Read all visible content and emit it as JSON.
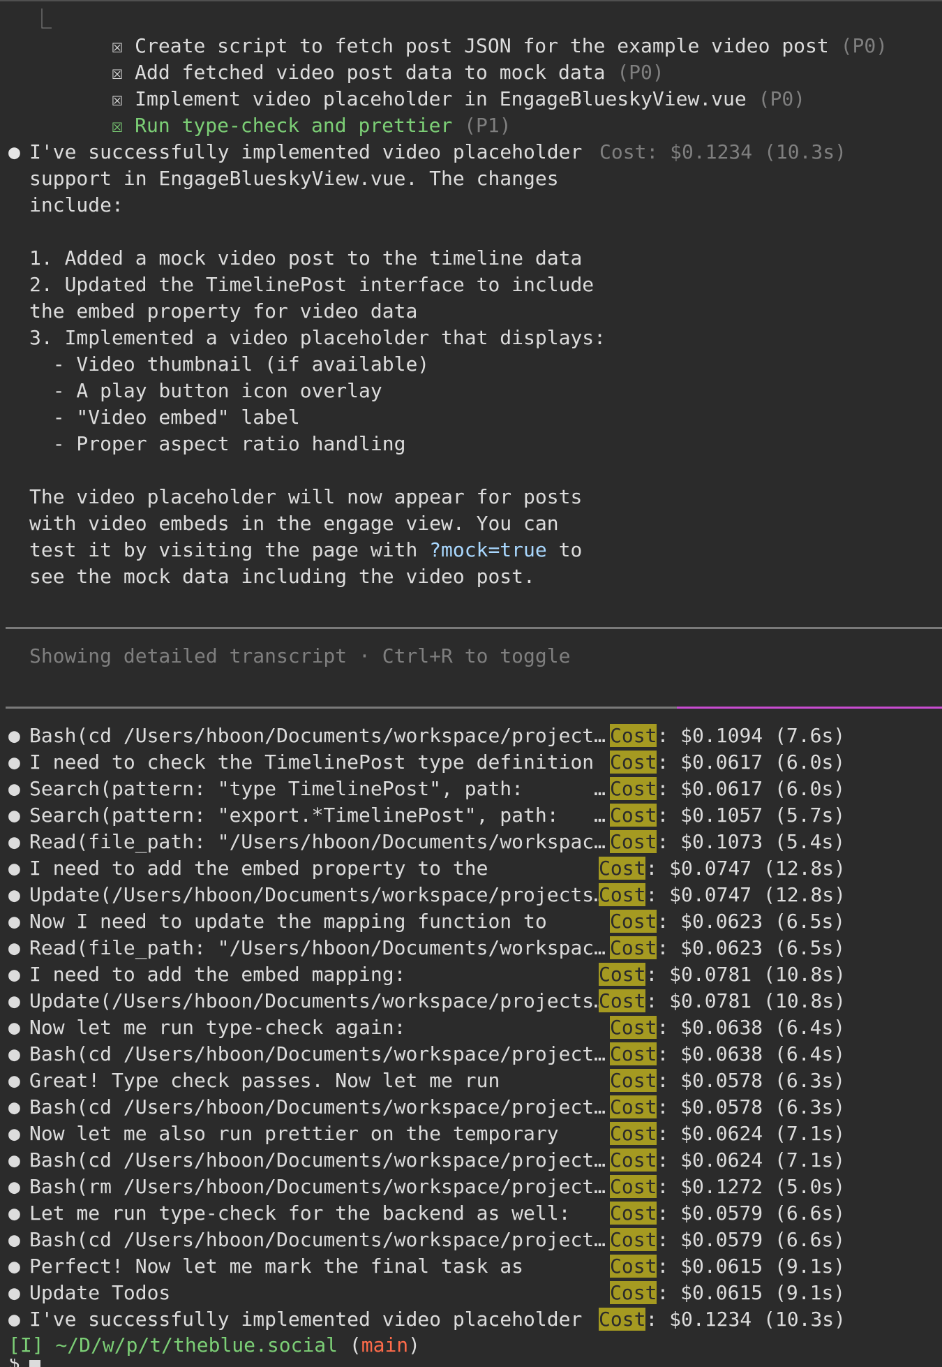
{
  "todos": [
    {
      "branch": "⎿",
      "box": "☒",
      "text": "Create script to fetch post JSON for the example video post",
      "priority": "(P0)",
      "done_highlight": false
    },
    {
      "branch": "",
      "box": "☒",
      "text": "Add fetched video post data to mock data",
      "priority": "(P0)",
      "done_highlight": false
    },
    {
      "branch": "",
      "box": "☒",
      "text": "Implement video placeholder in EngageBlueskyView.vue",
      "priority": "(P0)",
      "done_highlight": false
    },
    {
      "branch": "",
      "box": "☒",
      "text": "Run type-check and prettier",
      "priority": "(P1)",
      "done_highlight": true
    }
  ],
  "message": {
    "bullet": "●",
    "cost": "Cost: $0.1234 (10.3s)",
    "lines": [
      "I've successfully implemented video placeholder",
      "support in EngageBlueskyView.vue. The changes",
      "include:",
      "",
      "1. Added a mock video post to the timeline data",
      "2. Updated the TimelinePost interface to include",
      "the embed property for video data",
      "3. Implemented a video placeholder that displays:",
      "  - Video thumbnail (if available)",
      "  - A play button icon overlay",
      "  - \"Video embed\" label",
      "  - Proper aspect ratio handling",
      "",
      "The video placeholder will now appear for posts",
      "with video embeds in the engage view. You can"
    ],
    "line_test_pre": "test it by visiting the page with ",
    "line_test_code": "?mock=true",
    "line_test_post": " to",
    "line_last": "see the mock data including the video post."
  },
  "transcript_hint": "Showing detailed transcript · Ctrl+R to toggle",
  "transcript": [
    {
      "text": "Bash(cd /Users/hboon/Documents/workspace/project…",
      "cost_word": "Cost",
      "cost_rest": ": $0.1094 (7.6s)"
    },
    {
      "text": "I need to check the TimelinePost type definition",
      "cost_word": "Cost",
      "cost_rest": ": $0.0617 (6.0s)"
    },
    {
      "text": "Search(pattern: \"type TimelinePost\", path:      …",
      "cost_word": "Cost",
      "cost_rest": ": $0.0617 (6.0s)"
    },
    {
      "text": "Search(pattern: \"export.*TimelinePost\", path:   …",
      "cost_word": "Cost",
      "cost_rest": ": $0.1057 (5.7s)"
    },
    {
      "text": "Read(file_path: \"/Users/hboon/Documents/workspac…",
      "cost_word": "Cost",
      "cost_rest": ": $0.1073 (5.4s)"
    },
    {
      "text": "I need to add the embed property to the",
      "cost_word": "Cost",
      "cost_rest": ": $0.0747 (12.8s)"
    },
    {
      "text": "Update(/Users/hboon/Documents/workspace/projects…",
      "cost_word": "Cost",
      "cost_rest": ": $0.0747 (12.8s)"
    },
    {
      "text": "Now I need to update the mapping function to",
      "cost_word": "Cost",
      "cost_rest": ": $0.0623 (6.5s)"
    },
    {
      "text": "Read(file_path: \"/Users/hboon/Documents/workspac…",
      "cost_word": "Cost",
      "cost_rest": ": $0.0623 (6.5s)"
    },
    {
      "text": "I need to add the embed mapping:",
      "cost_word": "Cost",
      "cost_rest": ": $0.0781 (10.8s)"
    },
    {
      "text": "Update(/Users/hboon/Documents/workspace/projects…",
      "cost_word": "Cost",
      "cost_rest": ": $0.0781 (10.8s)"
    },
    {
      "text": "Now let me run type-check again:",
      "cost_word": "Cost",
      "cost_rest": ": $0.0638 (6.4s)"
    },
    {
      "text": "Bash(cd /Users/hboon/Documents/workspace/project…",
      "cost_word": "Cost",
      "cost_rest": ": $0.0638 (6.4s)"
    },
    {
      "text": "Great! Type check passes. Now let me run",
      "cost_word": "Cost",
      "cost_rest": ": $0.0578 (6.3s)"
    },
    {
      "text": "Bash(cd /Users/hboon/Documents/workspace/project…",
      "cost_word": "Cost",
      "cost_rest": ": $0.0578 (6.3s)"
    },
    {
      "text": "Now let me also run prettier on the temporary",
      "cost_word": "Cost",
      "cost_rest": ": $0.0624 (7.1s)"
    },
    {
      "text": "Bash(cd /Users/hboon/Documents/workspace/project…",
      "cost_word": "Cost",
      "cost_rest": ": $0.0624 (7.1s)"
    },
    {
      "text": "Bash(rm /Users/hboon/Documents/workspace/project…",
      "cost_word": "Cost",
      "cost_rest": ": $0.1272 (5.0s)"
    },
    {
      "text": "Let me run type-check for the backend as well:",
      "cost_word": "Cost",
      "cost_rest": ": $0.0579 (6.6s)"
    },
    {
      "text": "Bash(cd /Users/hboon/Documents/workspace/project…",
      "cost_word": "Cost",
      "cost_rest": ": $0.0579 (6.6s)"
    },
    {
      "text": "Perfect! Now let me mark the final task as",
      "cost_word": "Cost",
      "cost_rest": ": $0.0615 (9.1s)"
    },
    {
      "text": "Update Todos",
      "cost_word": "Cost",
      "cost_rest": ": $0.0615 (9.1s)"
    },
    {
      "text": "I've successfully implemented video placeholder",
      "cost_word": "Cost",
      "cost_rest": ": $0.1234 (10.3s)"
    }
  ],
  "prompt": {
    "mode": "[I]",
    "path": "~/D/w/p/t/theblue.social",
    "open": " (",
    "branch": "main",
    "close": ")",
    "next": "$"
  },
  "colors": {
    "background": "#2b2b2b",
    "text": "#dcdcdc",
    "dim": "#7f7f7f",
    "green": "#7ccf76",
    "highlight": "#a59a21",
    "branch_red": "#ff6b4a",
    "accent_magenta": "#c94cd2"
  }
}
